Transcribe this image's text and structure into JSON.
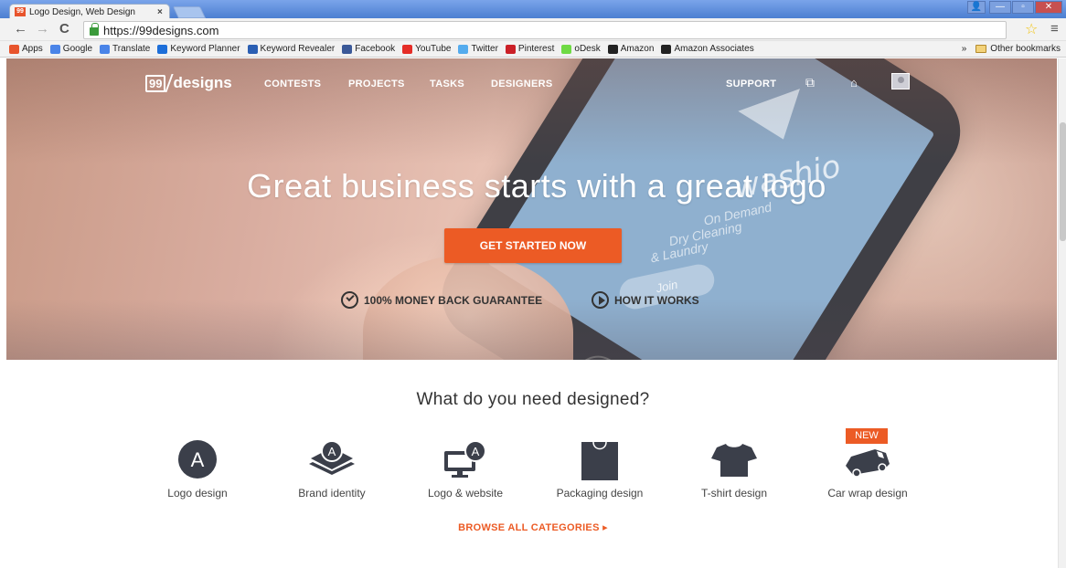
{
  "browser": {
    "tab_title": "Logo Design, Web Design",
    "tab_favicon": "99",
    "tab_close": "×",
    "url": "https://99designs.com",
    "bookmarks": [
      {
        "label": "Apps",
        "icon": "apps-grid-icon",
        "color": "#e8542c"
      },
      {
        "label": "Google",
        "icon": "google-icon",
        "color": "#4a84e8"
      },
      {
        "label": "Translate",
        "icon": "translate-icon",
        "color": "#4a84e8"
      },
      {
        "label": "Keyword Planner",
        "icon": "keyword-planner-icon",
        "color": "#1e6fd9"
      },
      {
        "label": "Keyword Revealer",
        "icon": "keyword-revealer-icon",
        "color": "#2b5fb3"
      },
      {
        "label": "Facebook",
        "icon": "facebook-icon",
        "color": "#3b5998"
      },
      {
        "label": "YouTube",
        "icon": "youtube-icon",
        "color": "#e52d27"
      },
      {
        "label": "Twitter",
        "icon": "twitter-icon",
        "color": "#55acee"
      },
      {
        "label": "Pinterest",
        "icon": "pinterest-icon",
        "color": "#cb2027"
      },
      {
        "label": "oDesk",
        "icon": "odesk-icon",
        "color": "#6fda44"
      },
      {
        "label": "Amazon",
        "icon": "amazon-icon",
        "color": "#222222"
      },
      {
        "label": "Amazon Associates",
        "icon": "amazon-icon",
        "color": "#222222"
      }
    ],
    "overflow_chevron": "»",
    "other_bookmarks": "Other bookmarks"
  },
  "site": {
    "logo_99": "99",
    "logo_word": "designs",
    "nav": {
      "contests": "CONTESTS",
      "projects": "PROJECTS",
      "tasks": "TASKS",
      "designers": "DESIGNERS",
      "support": "SUPPORT"
    },
    "hero": {
      "headline": "Great business starts with a great logo",
      "cta": "GET STARTED NOW",
      "guarantee": "100% MONEY BACK GUARANTEE",
      "how_it_works": "HOW IT WORKS",
      "phone_brand": "washio",
      "phone_tagline": [
        "On Demand",
        "Dry Cleaning",
        "& Laundry"
      ],
      "phone_join": "Join"
    },
    "categories_title": "What do you need designed?",
    "categories": [
      {
        "label": "Logo design",
        "icon": "logo-design-icon"
      },
      {
        "label": "Brand identity",
        "icon": "brand-identity-icon"
      },
      {
        "label": "Logo & website",
        "icon": "logo-website-icon"
      },
      {
        "label": "Packaging design",
        "icon": "packaging-design-icon"
      },
      {
        "label": "T-shirt design",
        "icon": "tshirt-design-icon"
      },
      {
        "label": "Car wrap design",
        "icon": "car-wrap-design-icon"
      }
    ],
    "new_badge": "NEW",
    "browse_all": "BROWSE ALL CATEGORIES ▸",
    "accent_color": "#ec5b25"
  }
}
